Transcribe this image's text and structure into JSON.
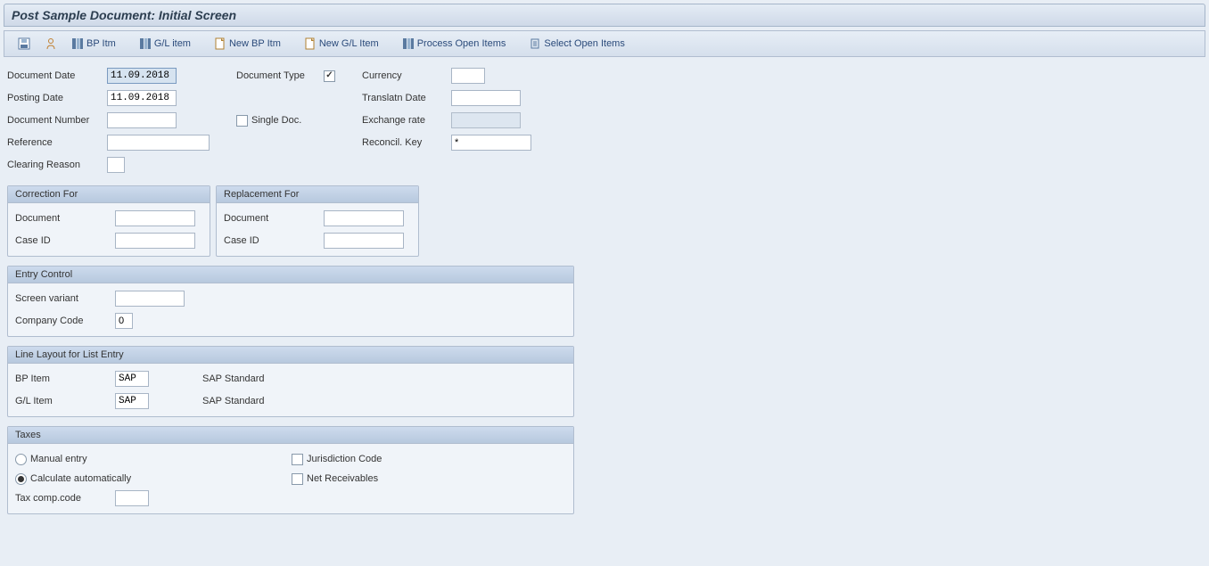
{
  "title": "Post Sample Document: Initial Screen",
  "toolbar": {
    "bp_itm": "BP Itm",
    "gl_item": "G/L item",
    "new_bp_itm": "New BP Itm",
    "new_gl_item": "New G/L Item",
    "process_open_items": "Process Open Items",
    "select_open_items": "Select Open Items"
  },
  "header": {
    "document_date_label": "Document Date",
    "document_date": "11.09.2018",
    "posting_date_label": "Posting Date",
    "posting_date": "11.09.2018",
    "document_number_label": "Document Number",
    "document_number": "",
    "reference_label": "Reference",
    "reference": "",
    "clearing_reason_label": "Clearing Reason",
    "clearing_reason": "",
    "document_type_label": "Document Type",
    "document_type_checked": true,
    "single_doc_label": "Single Doc.",
    "single_doc_checked": false,
    "currency_label": "Currency",
    "currency": "",
    "translatn_date_label": "Translatn Date",
    "translatn_date": "",
    "exchange_rate_label": "Exchange rate",
    "exchange_rate": "",
    "reconcil_key_label": "Reconcil. Key",
    "reconcil_key": "*"
  },
  "correction": {
    "title": "Correction For",
    "document_label": "Document",
    "document": "",
    "case_id_label": "Case ID",
    "case_id": ""
  },
  "replacement": {
    "title": "Replacement For",
    "document_label": "Document",
    "document": "",
    "case_id_label": "Case ID",
    "case_id": ""
  },
  "entry_control": {
    "title": "Entry Control",
    "screen_variant_label": "Screen variant",
    "screen_variant": "",
    "company_code_label": "Company Code",
    "company_code": "0"
  },
  "line_layout": {
    "title": "Line Layout for List Entry",
    "bp_item_label": "BP Item",
    "bp_item_value": "SAP",
    "bp_item_text": "SAP Standard",
    "gl_item_label": "G/L Item",
    "gl_item_value": "SAP",
    "gl_item_text": "SAP Standard"
  },
  "taxes": {
    "title": "Taxes",
    "manual_entry_label": "Manual entry",
    "calculate_auto_label": "Calculate automatically",
    "tax_comp_code_label": "Tax comp.code",
    "tax_comp_code": "",
    "jurisdiction_code_label": "Jurisdiction Code",
    "jurisdiction_checked": false,
    "net_receivables_label": "Net Receivables",
    "net_receivables_checked": false,
    "selected_radio": "calculate_auto"
  }
}
